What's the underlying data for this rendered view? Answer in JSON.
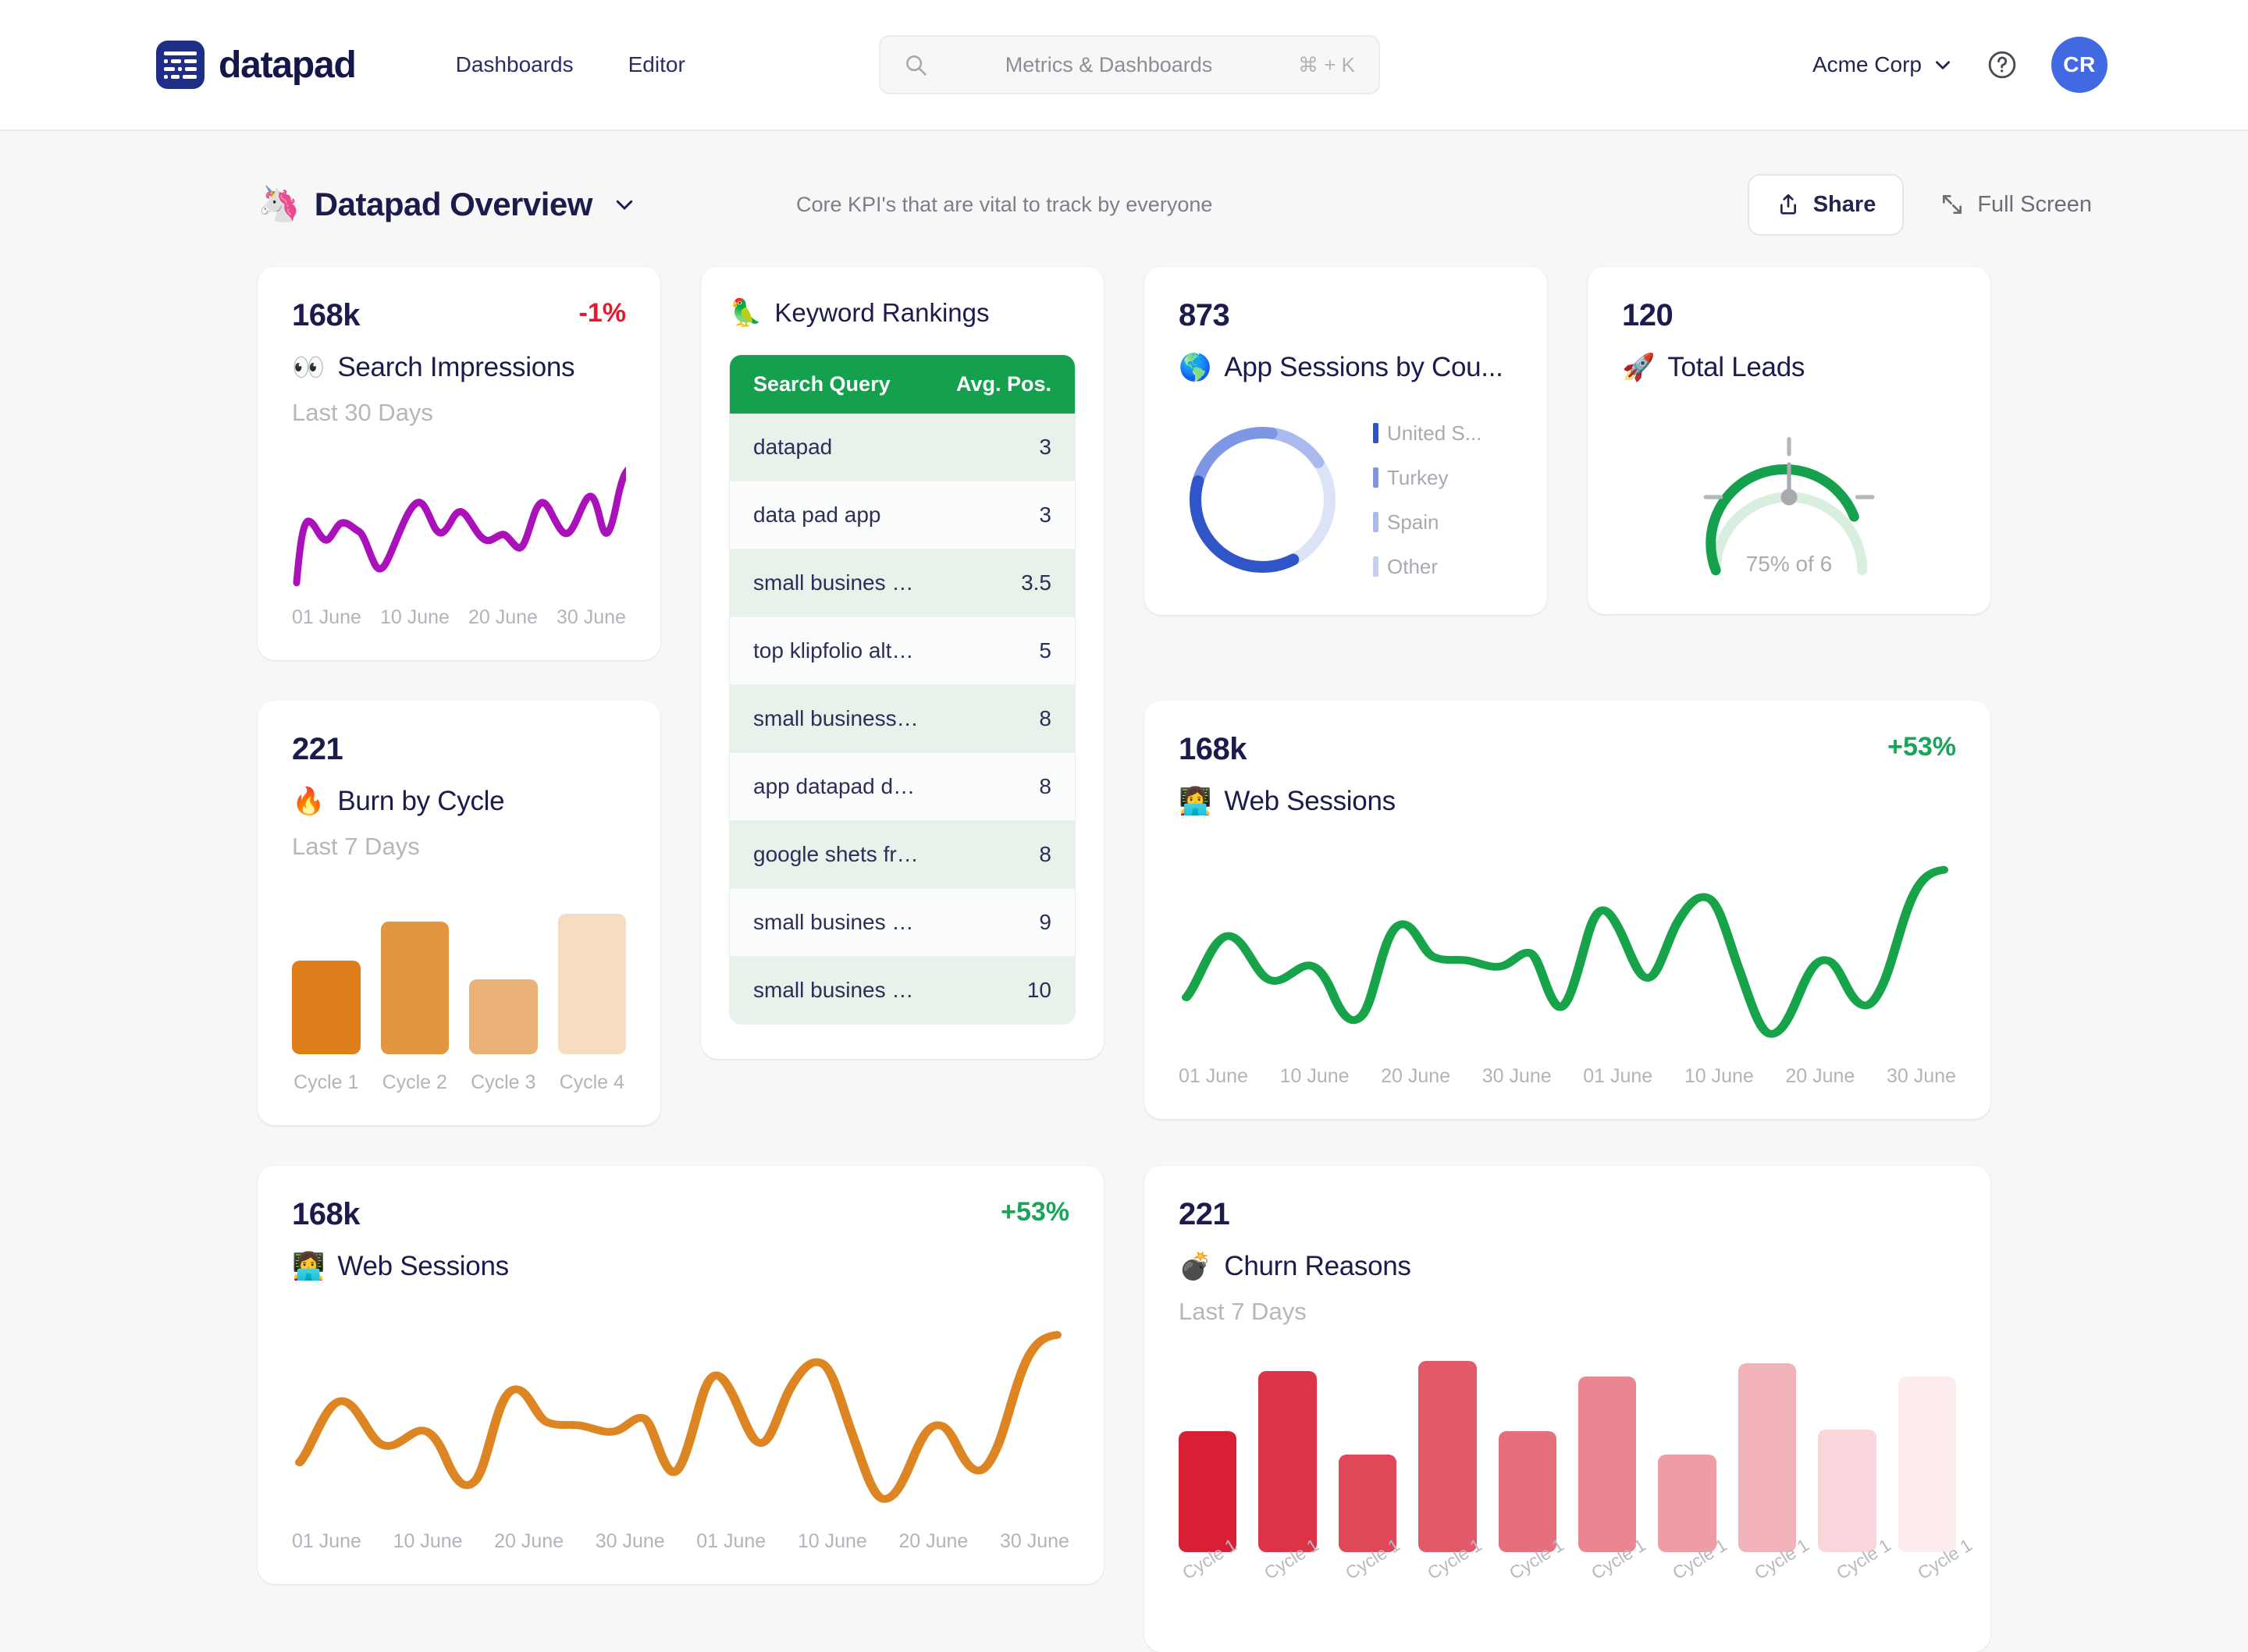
{
  "topbar": {
    "logo_word": "datapad",
    "logo_icon": "datapad-grid-logo",
    "nav": [
      {
        "label": "Dashboards"
      },
      {
        "label": "Editor"
      }
    ],
    "search": {
      "placeholder": "Metrics & Dashboards",
      "shortcut": "⌘ + K",
      "icon": "search-icon"
    },
    "org": {
      "name": "Acme Corp",
      "caret_icon": "chevron-down-icon"
    },
    "help_icon": "question-circle-icon",
    "avatar_initials": "CR"
  },
  "dashboard_header": {
    "emoji": "🦄",
    "title": "Datapad Overview",
    "caret_icon": "chevron-down-icon",
    "subtitle": "Core KPI's that are vital to track by everyone",
    "share_label": "Share",
    "share_icon": "share-upload-icon",
    "fullscreen_label": "Full Screen",
    "fullscreen_icon": "expand-arrows-icon"
  },
  "colors": {
    "brand_navy": "#1d2d88",
    "accent_blue": "#4169e1",
    "positive_green": "#18a558",
    "negative_red": "#e8192c",
    "purple_line": "#aa11bb",
    "green_line": "#16a34a",
    "orange_line": "#dd8522",
    "table_header_green": "#14a04d"
  },
  "cards": {
    "search_impressions": {
      "value": "168k",
      "delta": "-1%",
      "delta_sign": "negative",
      "emoji": "👀",
      "name": "Search Impressions",
      "period": "Last 30 Days"
    },
    "keyword_rankings": {
      "emoji": "🦜",
      "name": "Keyword Rankings",
      "columns": [
        "Search Query",
        "Avg. Pos."
      ],
      "rows": [
        {
          "query": "datapad",
          "pos": "3"
        },
        {
          "query": "data pad app",
          "pos": "3"
        },
        {
          "query": "small busines kpi d...",
          "pos": "3.5"
        },
        {
          "query": "top klipfolio alterna...",
          "pos": "5"
        },
        {
          "query": "small business kpis",
          "pos": "8"
        },
        {
          "query": "app datapad dashb...",
          "pos": "8"
        },
        {
          "query": "google shets free t...",
          "pos": "8"
        },
        {
          "query": "small busines kpi d...",
          "pos": "9"
        },
        {
          "query": "small busines kpi d...",
          "pos": "10"
        }
      ]
    },
    "app_sessions": {
      "value": "873",
      "emoji": "🌎",
      "name": "App Sessions by Cou..."
    },
    "total_leads": {
      "value": "120",
      "emoji": "🚀",
      "name": "Total Leads",
      "caption": "75% of 6"
    },
    "burn_by_cycle": {
      "value": "221",
      "emoji": "🔥",
      "name": "Burn by Cycle",
      "period": "Last 7 Days"
    },
    "web_sessions_green": {
      "value": "168k",
      "delta": "+53%",
      "delta_sign": "positive",
      "emoji": "👩‍💻",
      "name": "Web Sessions"
    },
    "web_sessions_orange": {
      "value": "168k",
      "delta": "+53%",
      "delta_sign": "positive",
      "emoji": "👩‍💻",
      "name": "Web Sessions"
    },
    "churn_reasons": {
      "value": "221",
      "emoji": "💣",
      "name": "Churn Reasons",
      "period": "Last 7 Days"
    }
  },
  "chart_data": [
    {
      "id": "search-impressions-sparkline",
      "type": "line",
      "title": "Search Impressions",
      "xlabel": "",
      "ylabel": "",
      "grid": false,
      "legend": "none",
      "line_color": "#aa11bb",
      "tick_labels": [
        "01 June",
        "10 June",
        "20 June",
        "30 June"
      ],
      "x": [
        0,
        1,
        2,
        3,
        4,
        5,
        6,
        7,
        8,
        9,
        10,
        11,
        12,
        13,
        14,
        15,
        16,
        17,
        18,
        19,
        20,
        21,
        22,
        23,
        24,
        25,
        26,
        27,
        28,
        29
      ],
      "values": [
        8,
        34,
        30,
        26,
        34,
        32,
        24,
        14,
        10,
        22,
        40,
        46,
        38,
        30,
        42,
        48,
        36,
        34,
        32,
        26,
        38,
        52,
        44,
        38,
        46,
        56,
        52,
        40,
        48,
        70
      ]
    },
    {
      "id": "app-sessions-donut",
      "type": "pie",
      "title": "App Sessions by Country",
      "total": 873,
      "legend": "right",
      "categories": [
        "United S...",
        "Turkey",
        "Spain",
        "Other"
      ],
      "values": [
        37,
        22,
        13,
        28
      ],
      "slice_colors": [
        "#2f55c8",
        "#7d97e5",
        "#aabaee",
        "#dde3f7"
      ]
    },
    {
      "id": "total-leads-gauge",
      "type": "gauge",
      "title": "Total Leads",
      "value": 120,
      "percent": 75,
      "max_label": "6",
      "caption": "75% of 6",
      "arc_color": "#14a04d",
      "track_color": "#d8eedf"
    },
    {
      "id": "burn-by-cycle-bars",
      "type": "bar",
      "title": "Burn by Cycle",
      "xlabel": "",
      "ylabel": "",
      "grid": false,
      "categories": [
        "Cycle 1",
        "Cycle 2",
        "Cycle 3",
        "Cycle 4"
      ],
      "values": [
        60,
        85,
        48,
        90
      ],
      "bar_colors": [
        "#dd7e1b",
        "#e3953f",
        "#eab277",
        "#f6ddbf"
      ]
    },
    {
      "id": "web-sessions-green-line",
      "type": "line",
      "title": "Web Sessions",
      "grid": false,
      "legend": "none",
      "line_color": "#16a34a",
      "tick_labels": [
        "01 June",
        "10 June",
        "20 June",
        "30 June",
        "01 June",
        "10 June",
        "20 June",
        "30 June"
      ],
      "x": [
        0,
        1,
        2,
        3,
        4,
        5,
        6,
        7,
        8,
        9,
        10,
        11,
        12,
        13,
        14,
        15,
        16,
        17,
        18,
        19,
        20,
        21,
        22,
        23
      ],
      "values": [
        22,
        44,
        50,
        36,
        32,
        45,
        48,
        12,
        42,
        66,
        52,
        50,
        48,
        52,
        50,
        20,
        65,
        38,
        72,
        60,
        5,
        18,
        44,
        22,
        88
      ]
    },
    {
      "id": "web-sessions-orange-line",
      "type": "line",
      "title": "Web Sessions",
      "grid": false,
      "legend": "none",
      "line_color": "#dd8522",
      "tick_labels": [
        "01 June",
        "10 June",
        "20 June",
        "30 June",
        "01 June",
        "10 June",
        "20 June",
        "30 June"
      ],
      "x": [
        0,
        1,
        2,
        3,
        4,
        5,
        6,
        7,
        8,
        9,
        10,
        11,
        12,
        13,
        14,
        15,
        16,
        17,
        18,
        19,
        20,
        21,
        22,
        23
      ],
      "values": [
        22,
        44,
        50,
        36,
        32,
        45,
        48,
        12,
        42,
        66,
        52,
        50,
        48,
        52,
        50,
        20,
        65,
        38,
        72,
        60,
        5,
        18,
        44,
        22,
        88
      ]
    },
    {
      "id": "churn-reasons-bars",
      "type": "bar",
      "title": "Churn Reasons",
      "grid": false,
      "categories": [
        "Cycle 1",
        "Cycle 1",
        "Cycle 1",
        "Cycle 1",
        "Cycle 1",
        "Cycle 1",
        "Cycle 1",
        "Cycle 1",
        "Cycle 1",
        "Cycle 1"
      ],
      "values": [
        62,
        93,
        50,
        98,
        62,
        90,
        50,
        97,
        63,
        90
      ],
      "bar_colors": [
        "#d91f35",
        "#dd3347",
        "#e04759",
        "#e2596a",
        "#e66f7e",
        "#ea8692",
        "#ee9ca6",
        "#f2b3bb",
        "#f8d6db",
        "#fcecee"
      ]
    }
  ]
}
